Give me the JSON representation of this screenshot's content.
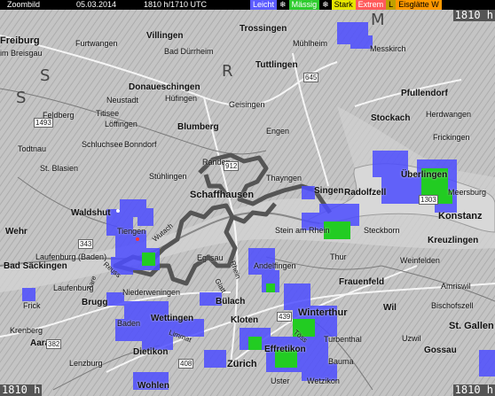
{
  "header": {
    "zoom_label": "Zoombild",
    "date": "05.03.2014",
    "time": "1810 h/1710 UTC",
    "legend": [
      {
        "label": "Leicht",
        "color": "#5b5bff",
        "text_color": "#ffffff"
      },
      {
        "label": "Mässig",
        "color": "#2ecc2e",
        "text_color": "#ffffff"
      },
      {
        "label": "Stark",
        "color": "#e6e600",
        "text_color": "#000000"
      },
      {
        "label": "Extrem",
        "color": "#ff5a5a",
        "text_color": "#ffffff"
      },
      {
        "label": "L",
        "color": "#c0a000",
        "text_color": "#000000"
      },
      {
        "label": "Eisglätte W",
        "color": "#ff9900",
        "text_color": "#000000"
      }
    ],
    "snow_icon": "snowflake-icon"
  },
  "corners": {
    "top_right": "1810 h",
    "bottom_left": "1810 h",
    "bottom_right": "1810 h"
  },
  "colors": {
    "light": "#4d4dff",
    "moderate": "#22cc22",
    "border": "#555555",
    "lake": "#cfcfcf"
  },
  "places": {
    "freiburg": "Freiburg",
    "breisgau": "im Breisgau",
    "furtwangen": "Furtwangen",
    "villingen": "Villingen",
    "bad_durrheim": "Bad Dürrheim",
    "trossingen": "Trossingen",
    "muhlheim": "Mühlheim",
    "messkirch": "Messkirch",
    "tuttlingen": "Tuttlingen",
    "donaueschingen": "Donaueschingen",
    "hufingen": "Hüfingen",
    "geisingen": "Geisingen",
    "pfullendorf": "Pfullendorf",
    "feldberg": "Feldberg",
    "titisee": "Titisee",
    "neustadt": "Neustadt",
    "loffingen": "Löffingen",
    "stockach": "Stockach",
    "herdwangen": "Herdwangen",
    "blumberg": "Blumberg",
    "engen": "Engen",
    "bonndorf": "Bonndorf",
    "schluchsee": "Schluchsee",
    "frickingen": "Frickingen",
    "todtnau": "Todtnau",
    "randen": "Randen",
    "thayngen": "Thayngen",
    "singen": "Singen",
    "radolfzell": "Radolfzell",
    "uberlingen": "Überlingen",
    "meersburg": "Meersburg",
    "st_blasien": "St. Blasien",
    "stuhlingen": "Stühlingen",
    "schaffhausen": "Schaffhausen",
    "konstanz": "Konstanz",
    "kreuzlingen": "Kreuzlingen",
    "wehr": "Wehr",
    "waldshut": "Waldshut",
    "tiengen": "Tiengen",
    "stein_am_rhein": "Stein am Rhein",
    "steckborn": "Steckborn",
    "bad_sackingen": "Bad Säckingen",
    "laufenburg_baden": "Laufenburg (Baden)",
    "laufenburg": "Laufenburg",
    "eglisau": "Eglisau",
    "andelfingen": "Andelfingen",
    "thur": "Thur",
    "weinfelden": "Weinfelden",
    "frauenfeld": "Frauenfeld",
    "amriswil": "Amriswil",
    "frick": "Frick",
    "niederweningen": "Niederweningen",
    "brugg": "Brugg",
    "bulach": "Bülach",
    "bischofszell": "Bischofszell",
    "wil": "Wil",
    "wettingen": "Wettingen",
    "baden": "Baden",
    "kloten": "Kloten",
    "winterthur": "Winterthur",
    "st_gallen": "St. Gallen",
    "lenzburg": "Lenzburg",
    "aarau": "Aarau",
    "dietikon": "Dietikon",
    "effretikon": "Effretikon",
    "turbenthal": "Turbenthal",
    "gossau": "Gossau",
    "uzwil": "Uzwil",
    "zurich": "Zürich",
    "wohlen": "Wohlen",
    "uster": "Uster",
    "wetzikon": "Wetzikon",
    "bauma": "Bauma",
    "kronberg": "Krenberg",
    "rhein": "Rhein",
    "aare": "Aare",
    "reuss": "Reuss",
    "glatt": "Glatt",
    "tess": "Töss",
    "limmat": "Limmat",
    "wutach": "Wutach",
    "letter_s1": "S",
    "letter_s2": "S",
    "letter_r": "R",
    "letter_p": "P",
    "letter_m": "M"
  },
  "roads": {
    "r1": "1493",
    "r2": "645",
    "r3": "1303",
    "r4": "912",
    "r5": "343",
    "r6": "465",
    "r7": "439",
    "r8": "382",
    "r9": "408"
  }
}
